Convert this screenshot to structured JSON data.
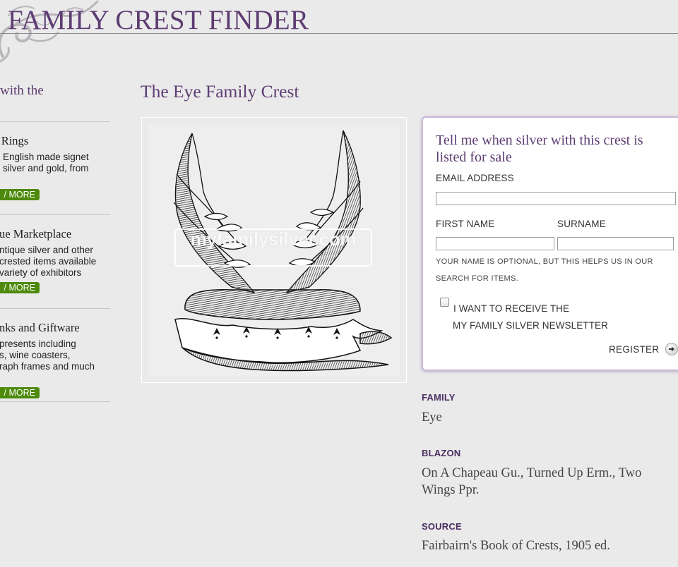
{
  "header": {
    "site_title": "FAMILY CREST FINDER"
  },
  "sidebar": {
    "intro": "with the",
    "promos": [
      {
        "title": "t Rings",
        "desc": [
          "English made signet",
          "silver and gold, from"
        ],
        "more": "/ MORE"
      },
      {
        "title": "ue Marketplace",
        "desc": [
          "ntique silver and other",
          "crested items available",
          "variety of exhibitors"
        ],
        "more": "/ MORE"
      },
      {
        "title": "nks and Giftware",
        "desc": [
          "presents including",
          "s, wine coasters,",
          "raph frames and much"
        ],
        "more": "/ MORE"
      }
    ]
  },
  "main": {
    "page_title": "The Eye Family Crest",
    "watermark": "myfamilysilver.com"
  },
  "register": {
    "title": "Tell me when silver with this crest is listed for sale",
    "email_label": "EMAIL ADDRESS",
    "email_value": "",
    "first_name_label": "FIRST NAME",
    "first_name_value": "",
    "surname_label": "SURNAME",
    "surname_value": "",
    "note": "YOUR NAME IS OPTIONAL, BUT THIS HELPS US IN OUR SEARCH FOR ITEMS.",
    "newsletter_line1": "I WANT TO RECEIVE THE",
    "newsletter_line2": "MY FAMILY SILVER NEWSLETTER",
    "newsletter_checked": false,
    "register_label": "REGISTER",
    "arrow_icon": "arrow-right-icon"
  },
  "details": {
    "family_label": "FAMILY",
    "family_value": "Eye",
    "blazon_label": "BLAZON",
    "blazon_value": "On A Chapeau Gu., Turned Up Erm., Two Wings Ppr.",
    "source_label": "SOURCE",
    "source_value": "Fairbairn's Book of Crests, 1905 ed."
  },
  "colors": {
    "brand_purple": "#5d3d72",
    "more_green": "#4d8a0c",
    "background": "#ebeaeb"
  }
}
